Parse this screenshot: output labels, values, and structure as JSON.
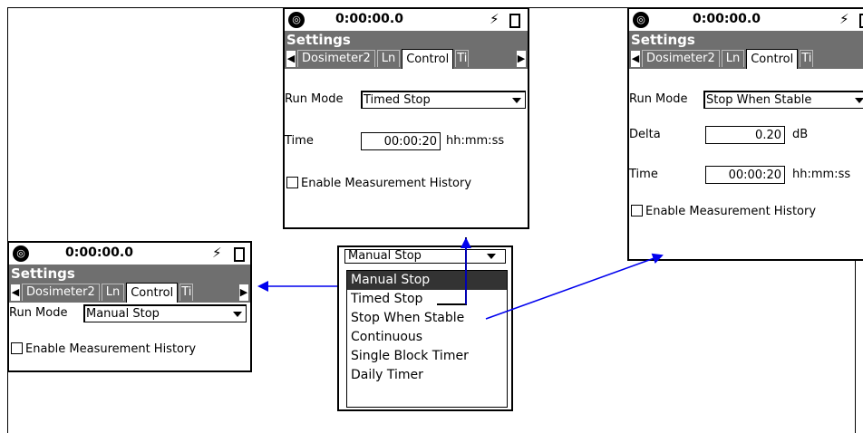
{
  "device": {
    "time": "0:00:00.0",
    "settings_title": "Settings",
    "tabs": [
      "Dosimeter2",
      "Ln",
      "Control",
      "Ti"
    ],
    "run_mode_label": "Run Mode",
    "enable_history_label": "Enable Measurement History",
    "icons": [
      "logo-icon",
      "power-bolt-icon",
      "battery-icon",
      "tab-left-arrow-icon",
      "tab-right-arrow-icon",
      "dropdown-arrow-icon",
      "checkbox-icon"
    ]
  },
  "panel_timed": {
    "run_mode_value": "Timed Stop",
    "time_label": "Time",
    "time_value": "00:00:20",
    "time_unit": "hh:mm:ss"
  },
  "panel_stable": {
    "run_mode_value": "Stop When Stable",
    "delta_label": "Delta",
    "delta_value": "0.20",
    "delta_unit": "dB",
    "time_label": "Time",
    "time_value": "00:00:20",
    "time_unit": "hh:mm:ss"
  },
  "panel_manual": {
    "run_mode_value": "Manual Stop"
  },
  "dropdown": {
    "current_value": "Manual Stop",
    "options": [
      "Manual Stop",
      "Timed Stop",
      "Stop When Stable",
      "Continuous",
      "Single Block Timer",
      "Daily Timer"
    ],
    "selected_index": 0
  },
  "colors": {
    "title_bar": "#6f6f6f",
    "arrow": "#0000ee",
    "selected_option": "#333333"
  }
}
